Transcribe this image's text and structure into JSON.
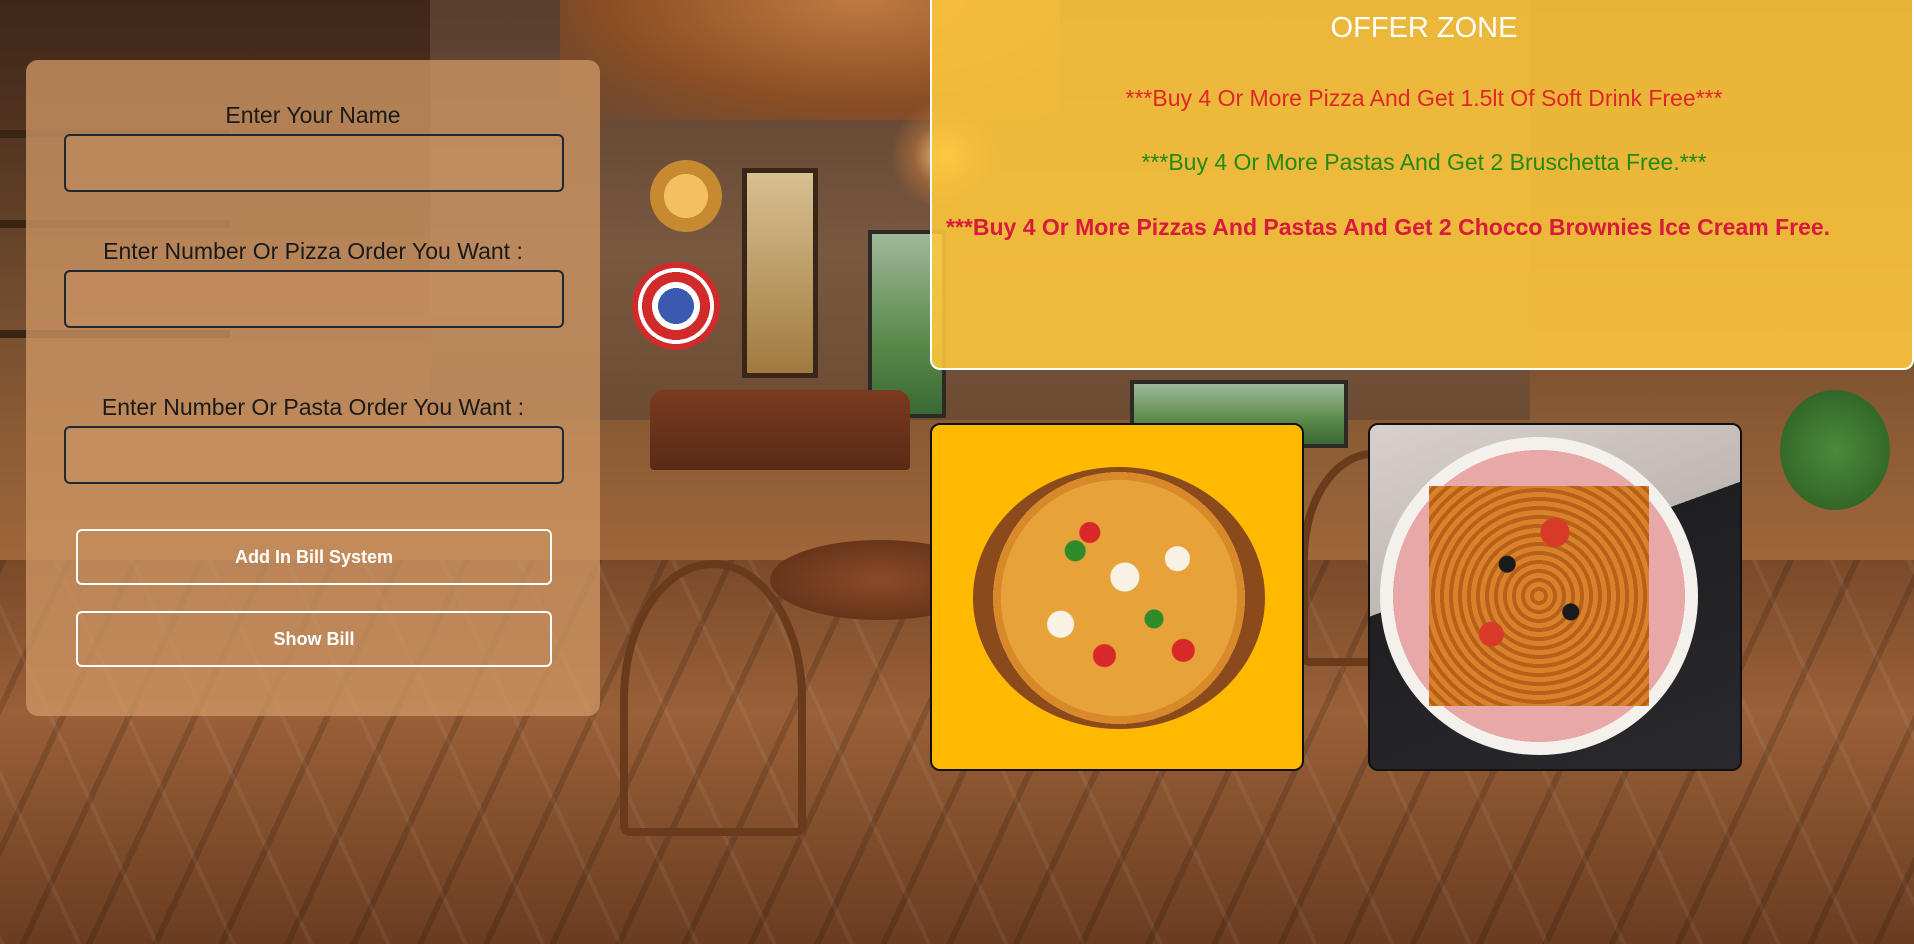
{
  "form": {
    "name_label": "Enter Your Name",
    "name_value": "",
    "pizza_label": "Enter Number Or Pizza Order You Want :",
    "pizza_value": "",
    "pasta_label": "Enter Number Or Pasta Order You Want :",
    "pasta_value": "",
    "add_button": "Add In Bill System",
    "show_button": "Show Bill"
  },
  "offers": {
    "title": "OFFER ZONE",
    "lines": [
      "***Buy 4 Or More Pizza And Get 1.5lt Of Soft Drink Free***",
      "***Buy 4 Or More Pastas And Get 2 Bruschetta Free.***",
      "***Buy 4 Or More Pizzas And Pastas And Get 2 Chocco Brownies Ice Cream Free."
    ],
    "colors": [
      "#e0262a",
      "#238a12",
      "#d81a3c"
    ]
  },
  "food": {
    "items": [
      "pizza-image",
      "pasta-image"
    ]
  },
  "theme": {
    "panel_color": "#cd9664",
    "offer_bg": "#ffc83c",
    "pizza_card_bg": "#ffba00"
  }
}
